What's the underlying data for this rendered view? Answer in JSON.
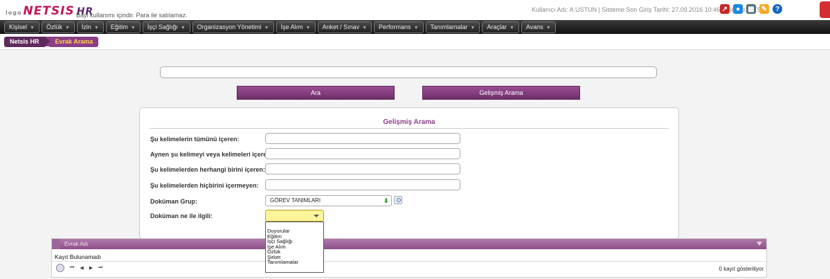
{
  "app": {
    "logo_prefix": "logo",
    "logo_text": "NETSIS",
    "logo_suffix": "HR",
    "dealer_text": "Bayi kullanımı içindir. Para ile satılamaz.",
    "user_info": "Kullanıcı Adı: A.USTUN | Sisteme Son Giriş Tarihi: 27.09.2016 10:46 | İşletme: NTS"
  },
  "menu": [
    "Kişisel",
    "Özlük",
    "İzin",
    "Eğitim",
    "İşçi Sağlığı",
    "Organizasyon Yönetimi",
    "İşe Alım",
    "Anket / Sınav",
    "Performans",
    "Tanımlamalar",
    "Araçlar",
    "Avans"
  ],
  "breadcrumb": {
    "root": "Netsis HR",
    "current": "Evrak Arama"
  },
  "search": {
    "value": "",
    "ara_button": "Ara",
    "advanced_button": "Gelişmiş Arama"
  },
  "advanced": {
    "title": "Gelişmiş Arama",
    "all_words_label": "Şu kelimelerin tümünü içeren:",
    "exact_phrase_label": "Aynen şu kelimeyi veya kelimeleri içeren:",
    "any_words_label": "Şu kelimelerden herhangi birini içeren:",
    "none_words_label": "Şu kelimelerden hiçbirini içermeyen:",
    "doc_group_label": "Doküman Grup:",
    "doc_group_value": "GÖREV TANIMLARI",
    "doc_related_label": "Doküman ne ile ilgili:",
    "doc_related_options": [
      "Duyurular",
      "Eğitim",
      "İşçi Sağlığı",
      "İşe Alım",
      "Özlük",
      "Şirket",
      "Tanımlamalar"
    ]
  },
  "grid": {
    "column": "Evrak Adı",
    "empty_text": "Kayıt Bulunamadı",
    "record_count": "0 kayıt gösteriliyor",
    "pager": {
      "first": "⏮",
      "prev": "◀",
      "next": "▶",
      "last": "⏭"
    }
  },
  "colors": {
    "brand": "#8b3f86",
    "accent": "#c2185b"
  }
}
